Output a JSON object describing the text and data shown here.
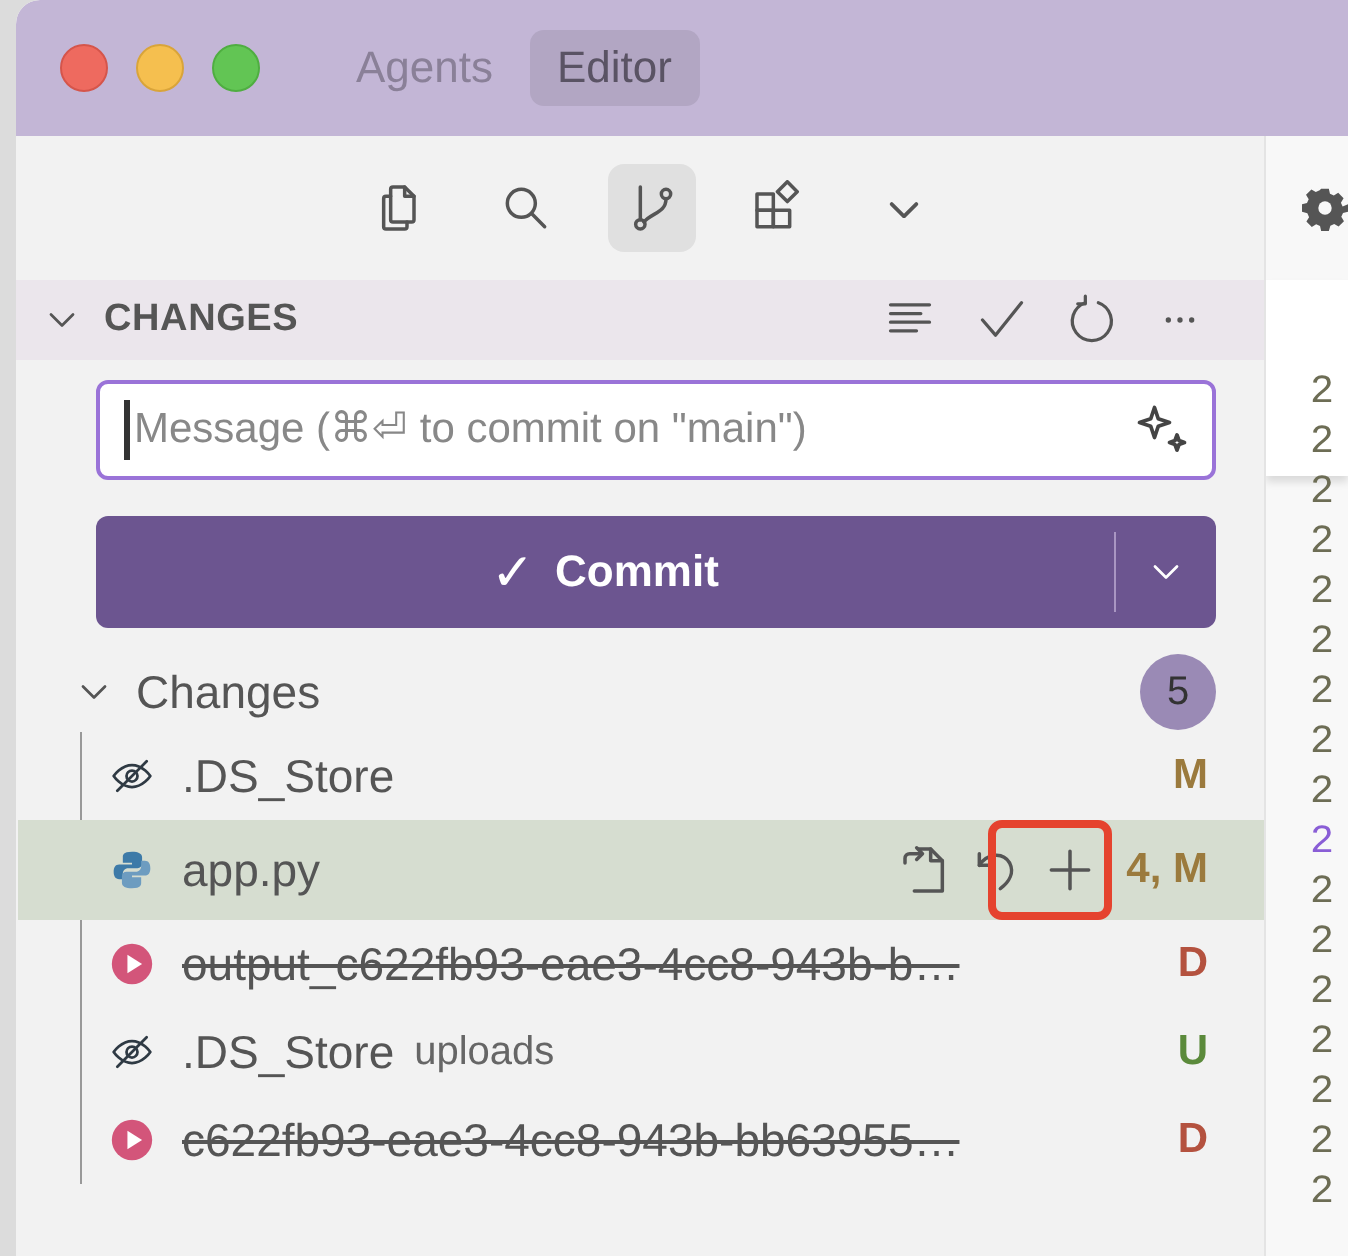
{
  "title_bar": {
    "tabs": [
      {
        "label": "Agents",
        "selected": false
      },
      {
        "label": "Editor",
        "selected": true
      }
    ]
  },
  "activity_bar": {
    "items": [
      {
        "kind": "files",
        "selected": false
      },
      {
        "kind": "search",
        "selected": false
      },
      {
        "kind": "source-control",
        "selected": true
      },
      {
        "kind": "extensions",
        "selected": false
      },
      {
        "kind": "more",
        "selected": false
      }
    ]
  },
  "section": {
    "title": "CHANGES",
    "expanded": true
  },
  "commit_message": {
    "placeholder": "Message (⌘⏎ to commit on \"main\")"
  },
  "commit_button": {
    "icon": "✓",
    "label": "Commit"
  },
  "group": {
    "label": "Changes",
    "count": "5",
    "expanded": true
  },
  "files": [
    {
      "kind": "hidden",
      "name": ".DS_Store",
      "deleted": false,
      "hovered": false,
      "status": "M",
      "color": "#9b7a3d"
    },
    {
      "kind": "python",
      "name": "app.py",
      "deleted": false,
      "hovered": true,
      "status": "4, M",
      "color": "#9b7a3d"
    },
    {
      "kind": "media",
      "name": "output_c622fb93-eae3-4cc8-943b-b…",
      "deleted": true,
      "hovered": false,
      "status": "D",
      "color": "#b4523f"
    },
    {
      "kind": "hidden",
      "name": ".DS_Store",
      "folder": "uploads",
      "deleted": false,
      "hovered": false,
      "status": "U",
      "color": "#5b8a3b"
    },
    {
      "kind": "media",
      "name": "c622fb93-eae3-4cc8-943b-bb63955…",
      "deleted": true,
      "hovered": false,
      "status": "D",
      "color": "#b4523f"
    }
  ],
  "editor": {
    "line_numbers": [
      {
        "text": "2",
        "current": false
      },
      {
        "text": "2",
        "current": false
      },
      {
        "text": "2",
        "current": false
      },
      {
        "text": "2",
        "current": false
      },
      {
        "text": "2",
        "current": false
      },
      {
        "text": "2",
        "current": false
      },
      {
        "text": "2",
        "current": false
      },
      {
        "text": "2",
        "current": false
      },
      {
        "text": "2",
        "current": false
      },
      {
        "text": "2",
        "current": true
      },
      {
        "text": "2",
        "current": false
      },
      {
        "text": "2",
        "current": false
      },
      {
        "text": "2",
        "current": false
      },
      {
        "text": "2",
        "current": false
      },
      {
        "text": "2",
        "current": false
      },
      {
        "text": "2",
        "current": false
      },
      {
        "text": "2",
        "current": false
      }
    ]
  }
}
